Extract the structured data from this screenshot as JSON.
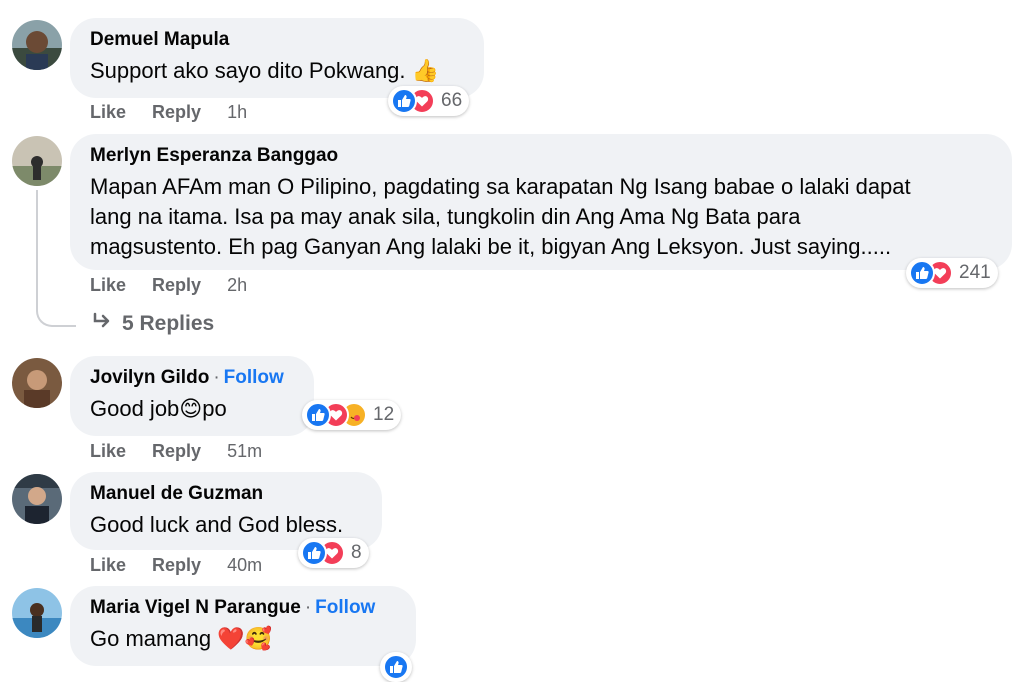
{
  "actions": {
    "like": "Like",
    "reply": "Reply",
    "follow": "Follow"
  },
  "comments": [
    {
      "name": "Demuel Mapula",
      "text": "Support ako sayo dito Pokwang.",
      "emoji": "👍",
      "time": "1h",
      "reactions": "66"
    },
    {
      "name": "Merlyn Esperanza Banggao",
      "lines": [
        "Mapan AFAm man O Pilipino, pagdating sa karapatan Ng Isang babae o lalaki dapat",
        "lang na itama. Isa pa may anak sila, tungkolin din Ang Ama Ng Bata para",
        "magsustento. Eh pag Ganyan Ang lalaki be it, bigyan Ang Leksyon. Just saying....."
      ],
      "time": "2h",
      "reactions": "241",
      "replies": "5 Replies"
    },
    {
      "name": "Jovilyn Gildo",
      "text_a": "Good job",
      "emoji": "😊",
      "text_b": "po",
      "time": "51m",
      "reactions": "12"
    },
    {
      "name": "Manuel de Guzman",
      "text": "Good luck and God bless.",
      "time": "40m",
      "reactions": "8"
    },
    {
      "name": "Maria Vigel N Parangue",
      "text": "Go mamang ",
      "emoji": "❤️🥰"
    }
  ],
  "colors": {
    "accent": "#1877f2",
    "like": "#1877f2",
    "love": "#f33e58",
    "bubble": "#f0f2f5"
  }
}
